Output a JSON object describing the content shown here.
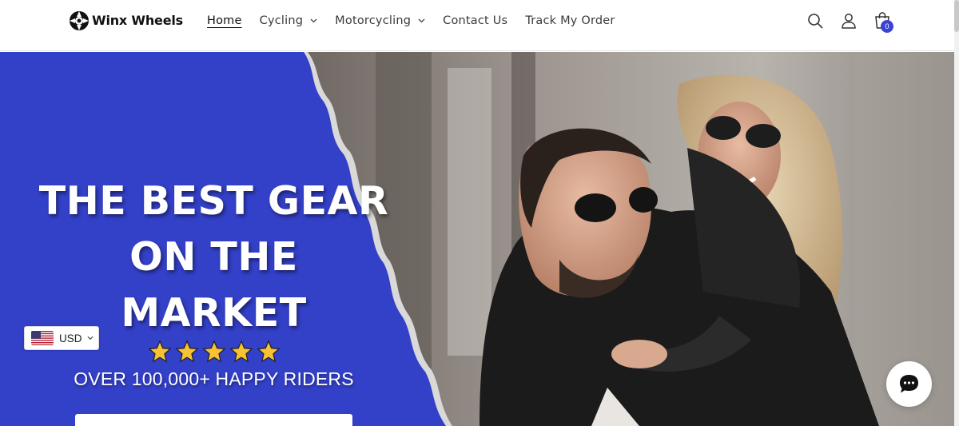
{
  "brand": {
    "name": "Winx Wheels"
  },
  "nav": {
    "items": [
      {
        "label": "Home",
        "active": true,
        "has_dropdown": false
      },
      {
        "label": "Cycling",
        "active": false,
        "has_dropdown": true
      },
      {
        "label": "Motorcycling",
        "active": false,
        "has_dropdown": true
      },
      {
        "label": "Contact Us",
        "active": false,
        "has_dropdown": false
      },
      {
        "label": "Track My Order",
        "active": false,
        "has_dropdown": false
      }
    ]
  },
  "header_icons": [
    "search-icon",
    "account-icon",
    "cart-icon"
  ],
  "cart": {
    "count": "0"
  },
  "hero": {
    "headline_lines": [
      "THE BEST GEAR",
      "ON THE",
      "MARKET"
    ],
    "rating_stars": 5,
    "subheadline": "OVER 100,000+ HAPPY RIDERS"
  },
  "currency": {
    "selected": "USD",
    "flag_icon": "us-flag-icon"
  },
  "chat": {
    "icon": "chat-bubble-icon"
  },
  "colors": {
    "brand_blue": "#3340c8",
    "badge_blue": "#3a43d6",
    "star_gold": "#f7c233",
    "header_bg": "#ffffff"
  }
}
